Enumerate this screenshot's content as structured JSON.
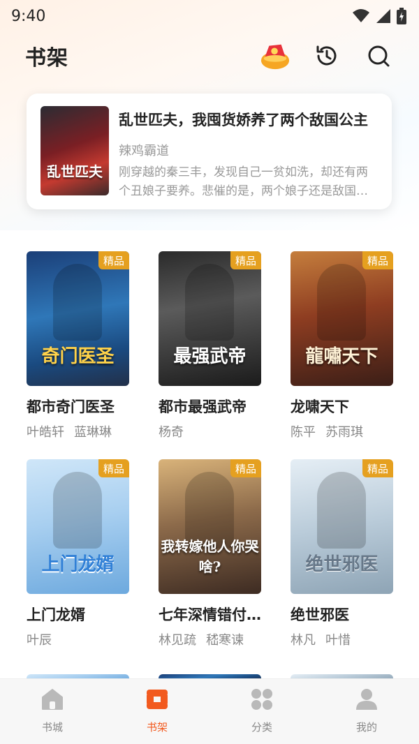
{
  "status_bar": {
    "time": "9:40"
  },
  "header": {
    "title": "书架"
  },
  "recent": {
    "title": "乱世匹夫，我囤货娇养了两个敌国公主",
    "author": "辣鸡霸道",
    "description": "刚穿越的秦三丰，发现自己一贫如洗，却还有两个丑娘子要养。悲催的是，两个娘子还是敌国公主……",
    "cover_title": "乱世匹夫"
  },
  "badge_label": "精品",
  "books": [
    {
      "title": "都市奇门医圣",
      "authors": [
        "叶皓轩",
        "蓝琳琳"
      ],
      "cover_text": "奇门医圣"
    },
    {
      "title": "都市最强武帝",
      "authors": [
        "杨奇"
      ],
      "cover_text": "最强武帝"
    },
    {
      "title": "龙啸天下",
      "authors": [
        "陈平",
        "苏雨琪"
      ],
      "cover_text": "龍嘯天下"
    },
    {
      "title": "上门龙婿",
      "authors": [
        "叶辰"
      ],
      "cover_text": "上门龙婿"
    },
    {
      "title": "七年深情错付，我转嫁他人你哭啥",
      "authors": [
        "林见疏",
        "嵇寒谏"
      ],
      "cover_text": "我转嫁他人你哭啥?"
    },
    {
      "title": "绝世邪医",
      "authors": [
        "林凡",
        "叶惜"
      ],
      "cover_text": "绝世邪医"
    }
  ],
  "nav": [
    {
      "label": "书城",
      "icon": "home-icon"
    },
    {
      "label": "书架",
      "icon": "bookshelf-icon"
    },
    {
      "label": "分类",
      "icon": "category-icon"
    },
    {
      "label": "我的",
      "icon": "profile-icon"
    }
  ],
  "colors": {
    "accent": "#f25a1f",
    "badge": "#e5a020"
  }
}
